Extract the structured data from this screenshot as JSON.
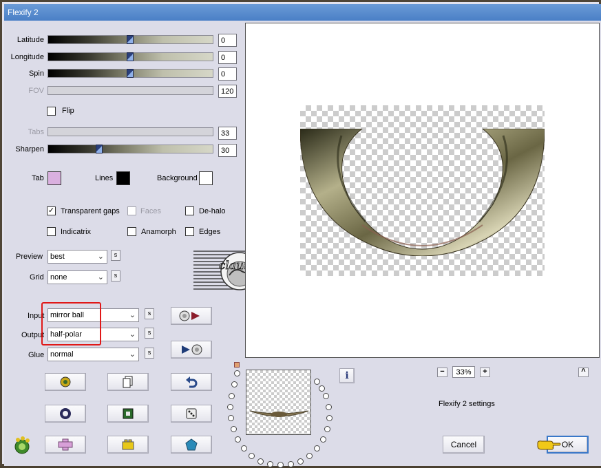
{
  "window": {
    "title": "Flexify 2"
  },
  "sliders": {
    "latitude": {
      "label": "Latitude",
      "value": "0"
    },
    "longitude": {
      "label": "Longitude",
      "value": "0"
    },
    "spin": {
      "label": "Spin",
      "value": "0"
    },
    "fov": {
      "label": "FOV",
      "value": "120"
    },
    "tabs": {
      "label": "Tabs",
      "value": "33"
    },
    "sharpen": {
      "label": "Sharpen",
      "value": "30"
    }
  },
  "flip": {
    "label": "Flip",
    "checked": false
  },
  "colors": {
    "tab": {
      "label": "Tab",
      "color": "#dab0df"
    },
    "lines": {
      "label": "Lines",
      "color": "#000000"
    },
    "background": {
      "label": "Background",
      "color": "#ffffff"
    }
  },
  "options": {
    "transparent_gaps": {
      "label": "Transparent gaps",
      "checked": true,
      "mark": "✓"
    },
    "faces": {
      "label": "Faces",
      "checked": false,
      "mark": ""
    },
    "de_halo": {
      "label": "De-halo",
      "checked": false,
      "mark": ""
    },
    "indicatrix": {
      "label": "Indicatrix",
      "checked": false,
      "mark": ""
    },
    "anamorph": {
      "label": "Anamorph",
      "checked": false,
      "mark": ""
    },
    "edges": {
      "label": "Edges",
      "checked": false,
      "mark": ""
    }
  },
  "dropdowns": {
    "preview": {
      "label": "Preview",
      "value": "best"
    },
    "grid": {
      "label": "Grid",
      "value": "none"
    },
    "input": {
      "label": "Input",
      "value": "mirror ball"
    },
    "output": {
      "label": "Output",
      "value": "half-polar"
    },
    "glue": {
      "label": "Glue",
      "value": "normal"
    }
  },
  "small_button": "s",
  "watermark": {
    "text": "claudia"
  },
  "zoom": {
    "minus": "−",
    "value": "33%",
    "plus": "+",
    "collapse": "^"
  },
  "settings_name": "Flexify 2 settings",
  "buttons": {
    "cancel": "Cancel",
    "ok": "OK"
  },
  "info": "i",
  "accent_colors": {
    "highlight": "#e01818",
    "titlebar": "#4a7fc6"
  }
}
